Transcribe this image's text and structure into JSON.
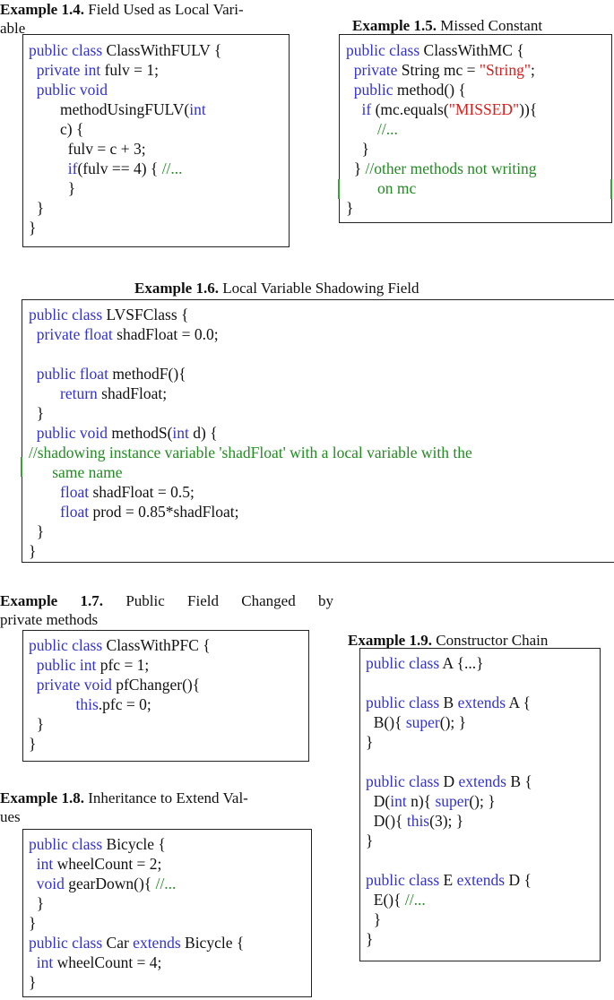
{
  "examples": {
    "ex14": {
      "label": "Example 1.4.",
      "title_line1": "Field Used as Local Vari-",
      "title_line2": "able"
    },
    "ex15": {
      "label": "Example 1.5.",
      "title": "Missed Constant"
    },
    "ex16": {
      "label": "Example 1.6.",
      "title": "Local Variable Shadowing Field"
    },
    "ex17": {
      "label": "Example 1.7.",
      "title_line1": "Public Field Changed by",
      "title_line2": "private methods"
    },
    "ex18": {
      "label": "Example 1.8.",
      "title_line1": "Inheritance to Extend Val-",
      "title_line2": "ues"
    },
    "ex19": {
      "label": "Example 1.9.",
      "title": "Constructor Chain"
    }
  },
  "code": {
    "ex14": [
      [
        [
          "kw",
          "public class"
        ],
        [
          "t",
          " ClassWithFULV {"
        ]
      ],
      [
        [
          "t",
          "  "
        ],
        [
          "kw",
          "private int"
        ],
        [
          "t",
          " fulv = 1;"
        ]
      ],
      [
        [
          "t",
          "  "
        ],
        [
          "kw",
          "public void"
        ]
      ],
      [
        [
          "t",
          "        methodUsingFULV("
        ],
        [
          "kw",
          "int"
        ]
      ],
      [
        [
          "t",
          "        c) {"
        ]
      ],
      [
        [
          "t",
          "          fulv = c + 3;"
        ]
      ],
      [
        [
          "t",
          "          "
        ],
        [
          "kw",
          "if"
        ],
        [
          "t",
          "(fulv == 4) { "
        ],
        [
          "cm",
          "//..."
        ]
      ],
      [
        [
          "t",
          "          }"
        ]
      ],
      [
        [
          "t",
          "  }"
        ]
      ],
      [
        [
          "t",
          "}"
        ]
      ]
    ],
    "ex15": [
      [
        [
          "kw",
          "public class"
        ],
        [
          "t",
          " ClassWithMC {"
        ]
      ],
      [
        [
          "t",
          "  "
        ],
        [
          "kw",
          "private"
        ],
        [
          "t",
          " String mc = "
        ],
        [
          "str",
          "\"String\""
        ],
        [
          "t",
          ";"
        ]
      ],
      [
        [
          "t",
          "  "
        ],
        [
          "kw",
          "public"
        ],
        [
          "t",
          " method() {"
        ]
      ],
      [
        [
          "t",
          "    "
        ],
        [
          "kw",
          "if"
        ],
        [
          "t",
          " (mc.equals("
        ],
        [
          "str",
          "\"MISSED\""
        ],
        [
          "t",
          ")){"
        ]
      ],
      [
        [
          "t",
          "        "
        ],
        [
          "cm",
          "//..."
        ]
      ],
      [
        [
          "t",
          "    }"
        ]
      ],
      [
        [
          "t",
          "  } "
        ],
        [
          "cm",
          "//other methods not writing"
        ]
      ],
      [
        [
          "cm",
          "        on mc"
        ]
      ],
      [
        [
          "t",
          "}"
        ]
      ]
    ],
    "ex16": [
      [
        [
          "kw",
          "public class"
        ],
        [
          "t",
          " LVSFClass {"
        ]
      ],
      [
        [
          "t",
          "  "
        ],
        [
          "kw",
          "private float"
        ],
        [
          "t",
          " shadFloat = 0.0;"
        ]
      ],
      [
        [
          "t",
          ""
        ]
      ],
      [
        [
          "t",
          "  "
        ],
        [
          "kw",
          "public float"
        ],
        [
          "t",
          " methodF(){"
        ]
      ],
      [
        [
          "t",
          "        "
        ],
        [
          "kw",
          "return"
        ],
        [
          "t",
          " shadFloat;"
        ]
      ],
      [
        [
          "t",
          "  }"
        ]
      ],
      [
        [
          "t",
          "  "
        ],
        [
          "kw",
          "public void"
        ],
        [
          "t",
          " methodS("
        ],
        [
          "kw",
          "int"
        ],
        [
          "t",
          " d) {"
        ]
      ],
      [
        [
          "cm",
          "//shadowing instance variable 'shadFloat' with a local variable with the"
        ]
      ],
      [
        [
          "cm",
          "      same name"
        ]
      ],
      [
        [
          "t",
          "        "
        ],
        [
          "kw",
          "float"
        ],
        [
          "t",
          " shadFloat = 0.5;"
        ]
      ],
      [
        [
          "t",
          "        "
        ],
        [
          "kw",
          "float"
        ],
        [
          "t",
          " prod = 0.85*shadFloat;"
        ]
      ],
      [
        [
          "t",
          "  }"
        ]
      ],
      [
        [
          "t",
          "}"
        ]
      ]
    ],
    "ex17": [
      [
        [
          "kw",
          "public class"
        ],
        [
          "t",
          " ClassWithPFC {"
        ]
      ],
      [
        [
          "t",
          "  "
        ],
        [
          "kw",
          "public int"
        ],
        [
          "t",
          " pfc = 1;"
        ]
      ],
      [
        [
          "t",
          "  "
        ],
        [
          "kw",
          "private void"
        ],
        [
          "t",
          " pfChanger(){"
        ]
      ],
      [
        [
          "t",
          "            "
        ],
        [
          "kw",
          "this"
        ],
        [
          "t",
          ".pfc = 0;"
        ]
      ],
      [
        [
          "t",
          "  }"
        ]
      ],
      [
        [
          "t",
          "}"
        ]
      ]
    ],
    "ex18": [
      [
        [
          "kw",
          "public class"
        ],
        [
          "t",
          " Bicycle {"
        ]
      ],
      [
        [
          "t",
          "  "
        ],
        [
          "kw",
          "int"
        ],
        [
          "t",
          " wheelCount = 2;"
        ]
      ],
      [
        [
          "t",
          "  "
        ],
        [
          "kw",
          "void"
        ],
        [
          "t",
          " gearDown(){ "
        ],
        [
          "cm",
          "//..."
        ]
      ],
      [
        [
          "t",
          "  }"
        ]
      ],
      [
        [
          "t",
          "}"
        ]
      ],
      [
        [
          "kw",
          "public class"
        ],
        [
          "t",
          " Car "
        ],
        [
          "kw",
          "extends"
        ],
        [
          "t",
          " Bicycle {"
        ]
      ],
      [
        [
          "t",
          "  "
        ],
        [
          "kw",
          "int"
        ],
        [
          "t",
          " wheelCount = 4;"
        ]
      ],
      [
        [
          "t",
          "}"
        ]
      ]
    ],
    "ex19": [
      [
        [
          "kw",
          "public class"
        ],
        [
          "t",
          " A {...}"
        ]
      ],
      [
        [
          "t",
          ""
        ]
      ],
      [
        [
          "kw",
          "public class"
        ],
        [
          "t",
          " B "
        ],
        [
          "kw",
          "extends"
        ],
        [
          "t",
          " A {"
        ]
      ],
      [
        [
          "t",
          "  B(){ "
        ],
        [
          "kw",
          "super"
        ],
        [
          "t",
          "(); }"
        ]
      ],
      [
        [
          "t",
          "}"
        ]
      ],
      [
        [
          "t",
          ""
        ]
      ],
      [
        [
          "kw",
          "public class"
        ],
        [
          "t",
          " D "
        ],
        [
          "kw",
          "extends"
        ],
        [
          "t",
          " B {"
        ]
      ],
      [
        [
          "t",
          "  D("
        ],
        [
          "kw",
          "int"
        ],
        [
          "t",
          " n){ "
        ],
        [
          "kw",
          "super"
        ],
        [
          "t",
          "(); }"
        ]
      ],
      [
        [
          "t",
          "  D(){ "
        ],
        [
          "kw",
          "this"
        ],
        [
          "t",
          "(3); }"
        ]
      ],
      [
        [
          "t",
          "}"
        ]
      ],
      [
        [
          "t",
          ""
        ]
      ],
      [
        [
          "kw",
          "public class"
        ],
        [
          "t",
          " E "
        ],
        [
          "kw",
          "extends"
        ],
        [
          "t",
          " D {"
        ]
      ],
      [
        [
          "t",
          "  E(){ "
        ],
        [
          "cm",
          "//..."
        ]
      ],
      [
        [
          "t",
          "  }"
        ]
      ],
      [
        [
          "t",
          "}"
        ]
      ]
    ]
  },
  "colors": {
    "keyword": "#3333cc",
    "string": "#d42020",
    "comment": "#228b22"
  }
}
